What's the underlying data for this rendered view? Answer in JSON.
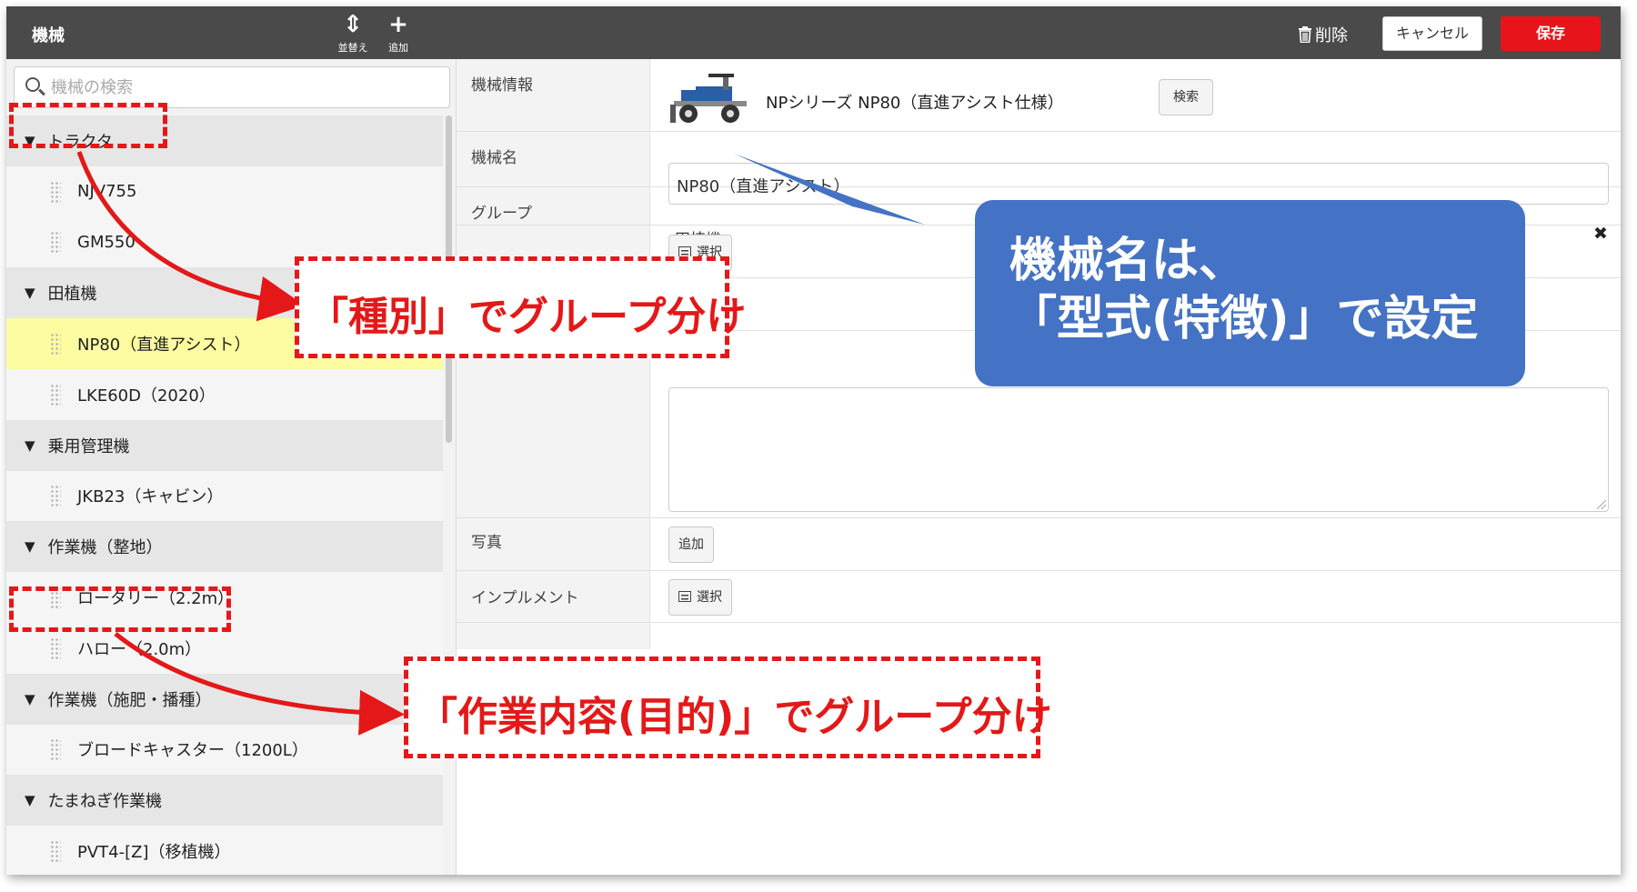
{
  "header": {
    "title": "機械",
    "sort_label": "並替え",
    "add_label": "追加",
    "delete_label": "削除",
    "cancel_label": "キャンセル",
    "save_label": "保存"
  },
  "search": {
    "placeholder": "機械の検索"
  },
  "tree": [
    {
      "type": "group",
      "label": "トラクタ"
    },
    {
      "type": "item",
      "label": "NJV755"
    },
    {
      "type": "item",
      "label": "GM550"
    },
    {
      "type": "group",
      "label": "田植機"
    },
    {
      "type": "item",
      "label": "NP80（直進アシスト）",
      "selected": true
    },
    {
      "type": "item",
      "label": "LKE60D（2020）"
    },
    {
      "type": "group",
      "label": "乗用管理機"
    },
    {
      "type": "item",
      "label": "JKB23（キャビン）"
    },
    {
      "type": "group",
      "label": "作業機（整地）"
    },
    {
      "type": "item",
      "label": "ロータリー（2.2m）"
    },
    {
      "type": "item",
      "label": "ハロー（2.0m）"
    },
    {
      "type": "group",
      "label": "作業機（施肥・播種）"
    },
    {
      "type": "item",
      "label": "ブロードキャスター（1200L）"
    },
    {
      "type": "group",
      "label": "たまねぎ作業機"
    },
    {
      "type": "item",
      "label": "PVT4-[Z]（移植機）"
    }
  ],
  "form": {
    "machine_info_label": "機械情報",
    "machine_model": "NPシリーズ NP80（直進アシスト仕様）",
    "search_button": "検索",
    "name_label": "機械名",
    "name_value": "NP80（直進アシスト）",
    "group_label": "グループ",
    "group_value": "田植機",
    "select_label": "選択",
    "photo_label": "写真",
    "photo_add": "追加",
    "implement_label": "インプルメント"
  },
  "annotations": {
    "callout_type": "「種別」でグループ分け",
    "callout_purpose": "「作業内容(目的)」でグループ分け",
    "bubble_line1": "機械名は、",
    "bubble_line2": "「型式(特徴)」で設定"
  },
  "colors": {
    "header_bg": "#4a4a4a",
    "save_button": "#e8141b",
    "selected_row": "#fdfca0",
    "annotation_red": "#e41818",
    "bubble_blue": "#4472c4"
  }
}
